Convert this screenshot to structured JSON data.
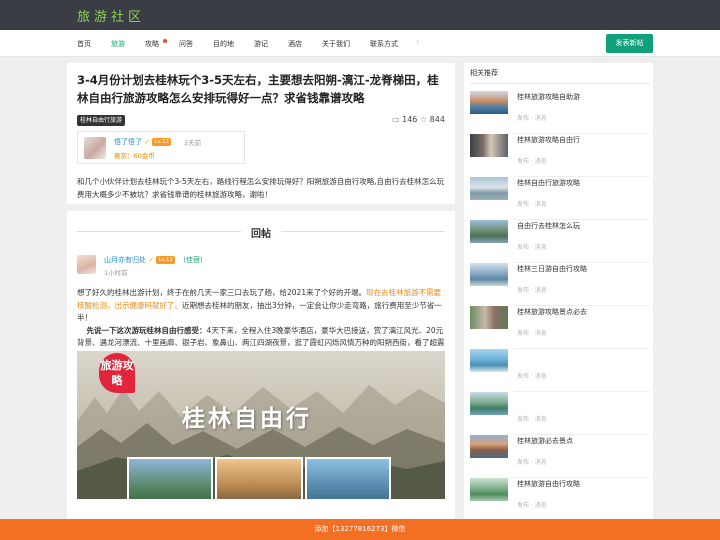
{
  "header": {
    "logo": "旅游社区"
  },
  "nav": {
    "items": [
      {
        "label": "首页",
        "active": false
      },
      {
        "label": "旅游",
        "active": true
      },
      {
        "label": "攻略",
        "active": false,
        "hot": true
      },
      {
        "label": "问答",
        "active": false
      },
      {
        "label": "目的地",
        "active": false
      },
      {
        "label": "游记",
        "active": false
      },
      {
        "label": "酒店",
        "active": false
      },
      {
        "label": "关于我们",
        "active": false
      },
      {
        "label": "联系方式",
        "active": false
      }
    ],
    "more": "‹",
    "post_button": "发表新帖"
  },
  "article": {
    "title": "3-4月份计划去桂林玩个3-5天左右，主要想去阳朔-漓江-龙脊梯田，桂林自由行旅游攻略怎么安排玩得好一点？求省钱靠谱攻略",
    "tag": "桂林自由行旅游",
    "comments": "146",
    "favorites": "844",
    "author": {
      "name": "悟了悟了",
      "level": "Lv.12",
      "time": "2天前",
      "coins": "悬赏：60金币"
    },
    "intro": "和几个小伙伴计划去桂林玩个3-5天左右，路线行程怎么安排玩得好？阳朔旅游自由行攻略,自由行去桂林怎么玩费用大概多少不被坑？求省钱靠谱的桂林旅游攻略，谢啦！"
  },
  "reply": {
    "heading": "回帖",
    "author": {
      "name": "山月亦有归处",
      "level": "Lv.12",
      "role": "(佳宿)",
      "time": "1小时前"
    },
    "body": {
      "p1_a": "想了好久的桂林出游计划，终于在前几天一家三口去玩了趟，给2021来了个好的开端。",
      "p1_hl": "现在去桂林旅游不需要核酸检测，出示健康码就好了。",
      "p1_b": "近期想去桂林的朋友，抽出3分钟，一定会让你少走弯路，旅行费用至少节省一半！",
      "p2_bold": "先说一下这次游玩桂林自由行感受：",
      "p2": "4天下来，全程入住3晚豪华酒店，豪华大巴接送，赏了漓江风光、20元背景、遇龙河漂流、十里画廊、银子岩、象鼻山、两江四湖夜景，逛了霞虹闪烁风情万种的阳朔西街，看了超震撼的千古情演出，品了桂林极具盛名的啤酒鱼、竹筒饭、桂林米粉等，而人均费用不到1000元，整体来说，是一次愉快费用又很划算的旅行，来看看我是怎么玩的吧！"
    },
    "poster": {
      "badge": "旅游攻略",
      "title": "桂林自由行"
    }
  },
  "sidebar": {
    "heading": "相关推荐",
    "items": [
      {
        "title": "桂林旅游攻略自助游",
        "meta": "发布  ·  消息"
      },
      {
        "title": "桂林旅游攻略自由行",
        "meta": "发布  ·  消息"
      },
      {
        "title": "桂林自由行旅游攻略",
        "meta": "发布  ·  消息"
      },
      {
        "title": "自由行去桂林怎么玩",
        "meta": "发布  ·  消息"
      },
      {
        "title": "桂林三日游自由行攻略",
        "meta": "发布  ·  消息"
      },
      {
        "title": "桂林旅游攻略景点必去",
        "meta": "发布  ·  消息"
      },
      {
        "title": "",
        "meta": "发布  ·  消息"
      },
      {
        "title": "",
        "meta": "发布  ·  消息"
      },
      {
        "title": "桂林旅游必去景点",
        "meta": "发布  ·  消息"
      },
      {
        "title": "桂林旅游自由行攻略",
        "meta": "发布  ·  消息"
      }
    ]
  },
  "footer": {
    "text": "添加【13277816273】微信"
  }
}
